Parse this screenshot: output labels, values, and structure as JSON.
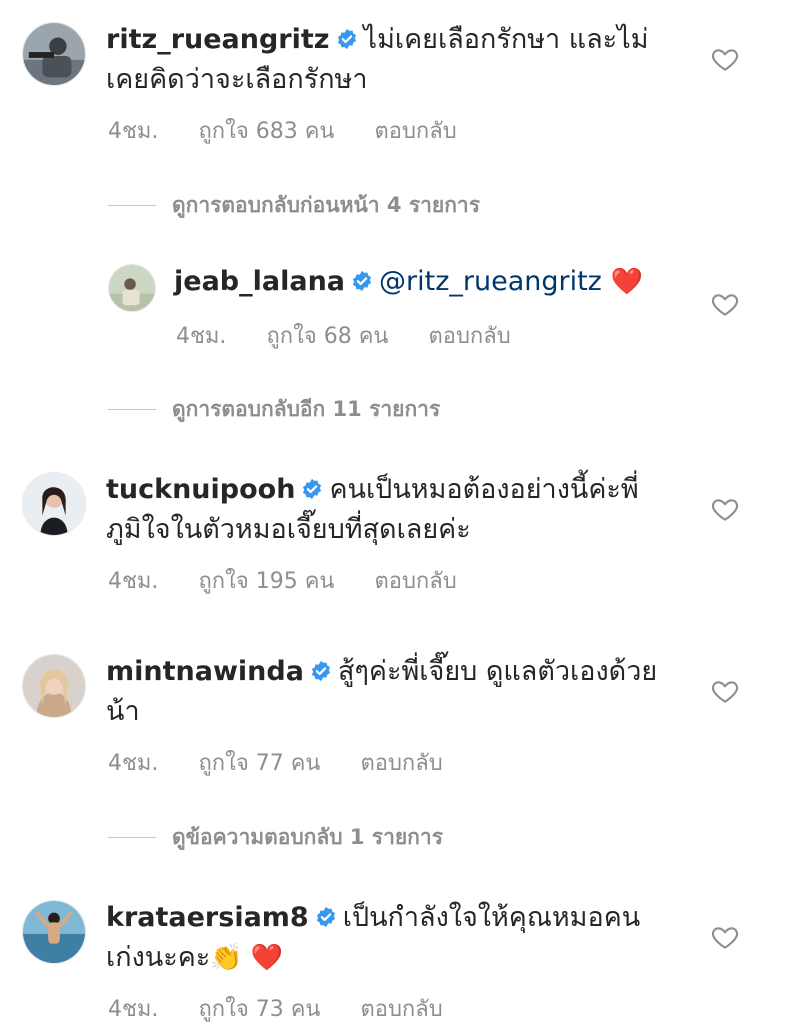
{
  "comments": [
    {
      "username": "ritz_rueangritz",
      "text_line1": "ไม่เคยเลือกรักษา และไม่",
      "text_line2": "เคยคิดว่าจะเลือกรักษา",
      "time": "4ชม.",
      "likes": "ถูกใจ 683 คน",
      "reply": "ตอบกลับ"
    },
    {
      "username": "jeab_lalana",
      "mention": "@ritz_rueangritz",
      "emoji": "❤️",
      "time": "4ชม.",
      "likes": "ถูกใจ 68 คน",
      "reply": "ตอบกลับ"
    },
    {
      "username": "tucknuipooh",
      "text_line1": "คนเป็นหมอต้องอย่างนี้ค่ะพี่",
      "text_line2": "ภูมิใจในตัวหมอเจี๊ยบที่สุดเลยค่ะ",
      "time": "4ชม.",
      "likes": "ถูกใจ 195 คน",
      "reply": "ตอบกลับ"
    },
    {
      "username": "mintnawinda",
      "text_line1": "สู้ๆค่ะพี่เจี๊ยบ ดูแลตัวเองด้วย",
      "text_line2": "น้า",
      "time": "4ชม.",
      "likes": "ถูกใจ 77 คน",
      "reply": "ตอบกลับ"
    },
    {
      "username": "krataersiam8",
      "text_line1": "เป็นกำลังใจให้คุณหมอคน",
      "text_line2": "เก่งนะคะ",
      "emoji": "👏 ❤️",
      "time": "4ชม.",
      "likes": "ถูกใจ 73 คน",
      "reply": "ตอบกลับ"
    }
  ],
  "view_replies": [
    "ดูการตอบกลับก่อนหน้า 4 รายการ",
    "ดูการตอบกลับอีก 11 รายการ",
    "ดูข้อความตอบกลับ 1 รายการ"
  ],
  "colors": {
    "text": "#262626",
    "meta": "#8e8e8e",
    "verified": "#3897f0",
    "mention": "#00376b"
  }
}
